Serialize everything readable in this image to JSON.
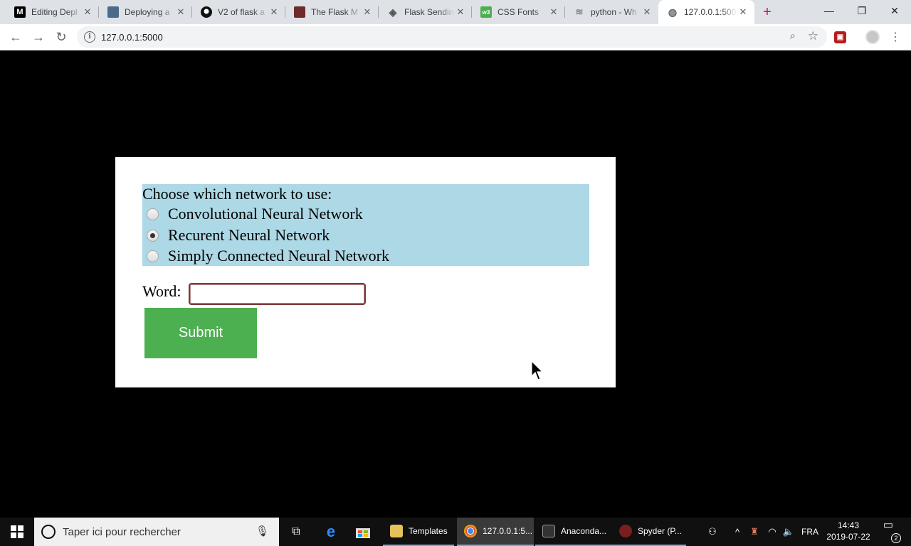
{
  "browser": {
    "tabs": [
      {
        "title": "Editing Depl",
        "favicon": "medium-icon"
      },
      {
        "title": "Deploying a",
        "favicon": "page-icon"
      },
      {
        "title": "V2 of flask a",
        "favicon": "github-icon"
      },
      {
        "title": "The Flask M",
        "favicon": "book-icon"
      },
      {
        "title": "Flask Sendin",
        "favicon": "diamond-icon"
      },
      {
        "title": "CSS Fonts",
        "favicon": "w3schools-icon"
      },
      {
        "title": "python - Wh",
        "favicon": "stackoverflow-icon"
      },
      {
        "title": "127.0.0.1:500",
        "favicon": "globe-icon"
      }
    ],
    "active_tab_index": 7,
    "address": "127.0.0.1:5000",
    "accent_color": "#c2185b"
  },
  "page": {
    "network_prompt": "Choose which network to use:",
    "networks": [
      {
        "label": "Convolutional Neural Network",
        "checked": false
      },
      {
        "label": "Recurent Neural Network",
        "checked": true
      },
      {
        "label": "Simply Connected Neural Network",
        "checked": false
      }
    ],
    "word_label": "Word:",
    "word_value": "",
    "submit_label": "Submit",
    "colors": {
      "background": "#000000",
      "card": "#ffffff",
      "network_box": "#add8e6",
      "submit_button": "#4caf50"
    }
  },
  "taskbar": {
    "search_placeholder": "Taper ici pour rechercher",
    "apps": [
      {
        "label": "Templates",
        "icon": "folder-icon",
        "active": false
      },
      {
        "label": "127.0.0.1:5...",
        "icon": "chrome-icon",
        "active": true
      },
      {
        "label": "Anaconda...",
        "icon": "terminal-icon",
        "active": false
      },
      {
        "label": "Spyder (P...",
        "icon": "spyder-icon",
        "active": false
      }
    ],
    "language": "FRA",
    "time": "14:43",
    "date": "2019-07-22",
    "notification_count": "2"
  }
}
